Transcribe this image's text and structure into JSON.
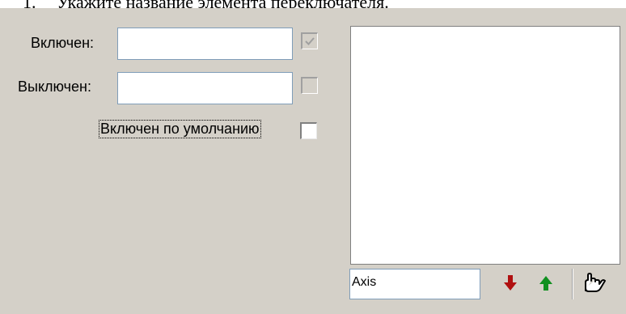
{
  "document": {
    "heading_number": "1.",
    "heading_text": "Укажите название элемента переключателя."
  },
  "form": {
    "on_label": "Включен:",
    "on_value": "",
    "on_checked": true,
    "on_checkbox_enabled": false,
    "off_label": "Выключен:",
    "off_value": "",
    "off_checked": false,
    "off_checkbox_enabled": false,
    "default_on_label": "Включен по умолчанию",
    "default_on_checked": false
  },
  "axis": {
    "input_value": "Axis"
  },
  "toolbar": {
    "down_icon": "arrow-down-icon",
    "up_icon": "arrow-up-icon",
    "action_icon": "hand-pointer-icon",
    "colors": {
      "down_arrow": "#b01010",
      "up_arrow": "#109020",
      "panel_bg": "#d4d0c8"
    }
  }
}
